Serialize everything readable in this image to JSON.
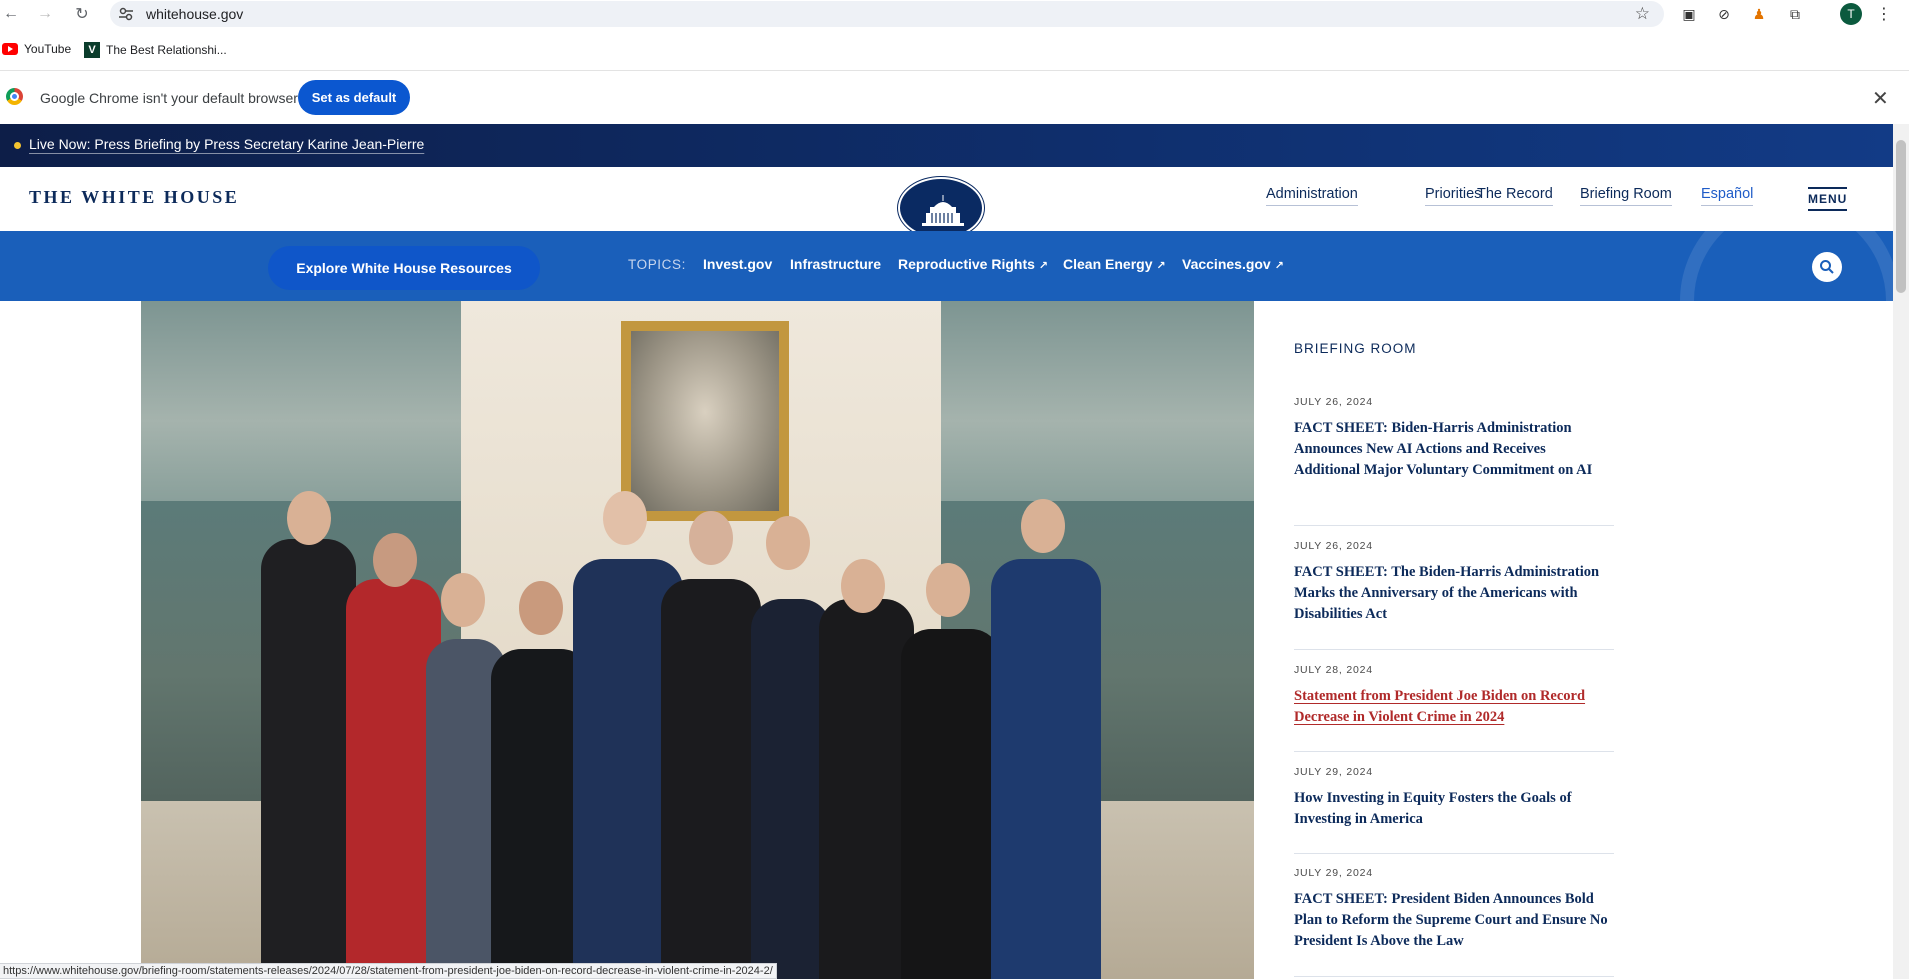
{
  "browser": {
    "url": "whitehouse.gov",
    "bookmarks": [
      "YouTube",
      "The Best Relationshi..."
    ],
    "avatar_letter": "T",
    "infobar_message": "Google Chrome isn't your default browser",
    "infobar_button": "Set as default",
    "status_url": "https://www.whitehouse.gov/briefing-room/statements-releases/2024/07/28/statement-from-president-joe-biden-on-record-decrease-in-violent-crime-in-2024-2/"
  },
  "live_banner": "Live Now: Press Briefing by Press Secretary Karine Jean-Pierre",
  "header": {
    "title": "THE WHITE HOUSE",
    "nav": [
      "Administration",
      "Priorities",
      "The Record",
      "Briefing Room",
      "Español"
    ],
    "menu_label": "MENU"
  },
  "topics_bar": {
    "explore_label": "Explore White House Resources",
    "topics_label": "TOPICS:",
    "topics": [
      {
        "label": "Invest.gov",
        "external": false
      },
      {
        "label": "Infrastructure",
        "external": false
      },
      {
        "label": "Reproductive Rights",
        "external": true
      },
      {
        "label": "Clean Energy",
        "external": true
      },
      {
        "label": "Vaccines.gov",
        "external": true
      }
    ]
  },
  "briefing_room": {
    "title": "BRIEFING ROOM",
    "items": [
      {
        "date": "JULY 26, 2024",
        "headline": "FACT SHEET: Biden-Harris Administration Announces New AI Actions and Receives Additional Major Voluntary Commitment on AI",
        "active": false
      },
      {
        "date": "JULY 26, 2024",
        "headline": "FACT SHEET: The Biden-Harris Administration Marks the Anniversary of the Americans with Disabilities Act",
        "active": false
      },
      {
        "date": "JULY 28, 2024",
        "headline": "Statement from President Joe Biden on Record Decrease in Violent Crime in 2024",
        "active": true
      },
      {
        "date": "JULY 29, 2024",
        "headline": "How Investing in Equity Fosters the Goals of Investing in America",
        "active": false
      },
      {
        "date": "JULY 29, 2024",
        "headline": "FACT SHEET: President Biden Announces Bold Plan to Reform the Supreme Court and Ensure No President Is Above the Law",
        "active": false
      }
    ]
  },
  "colors": {
    "navy": "#0c2a5a",
    "topics_blue": "#1a5fba",
    "active_link": "#b02a2a",
    "chrome_blue": "#0b57d0"
  }
}
